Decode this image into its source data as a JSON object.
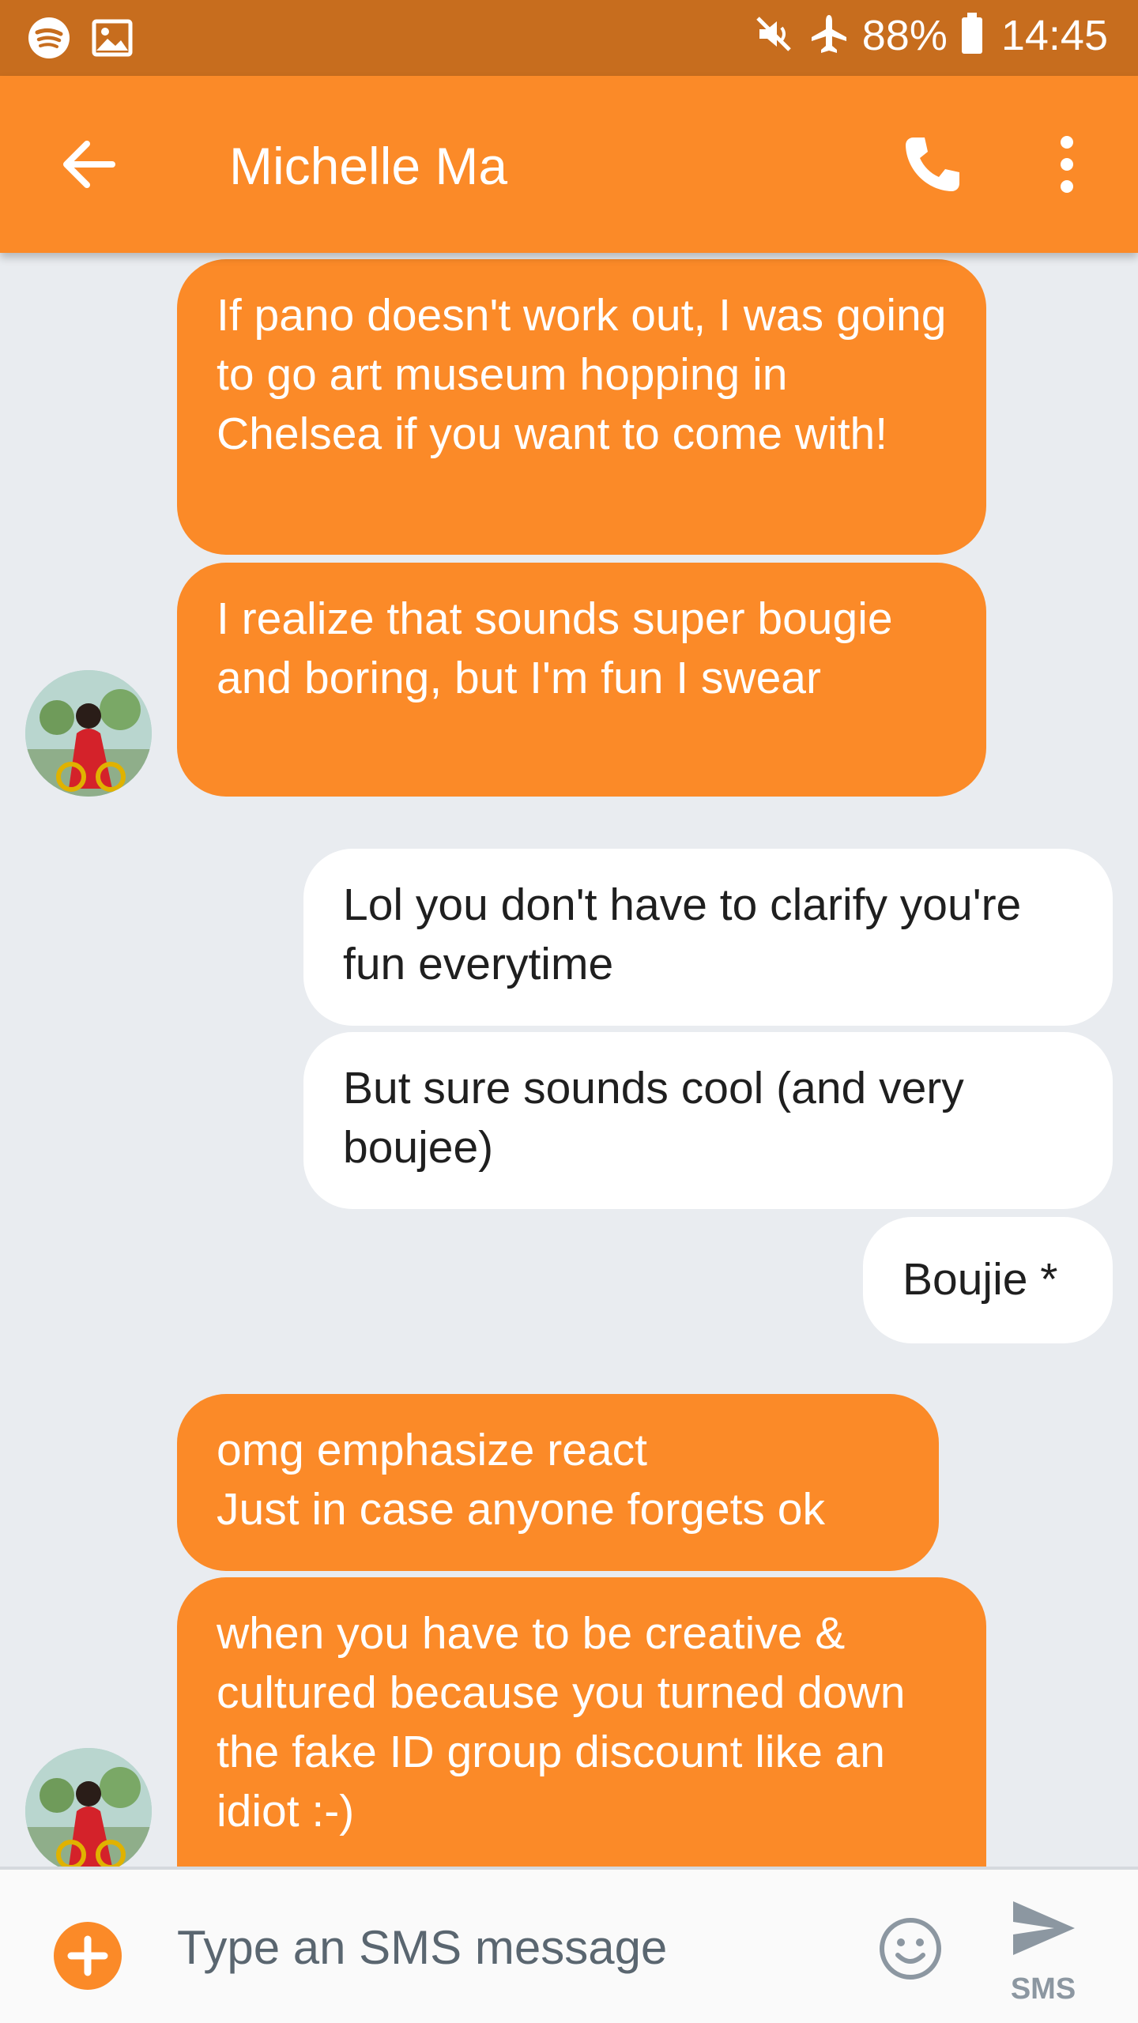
{
  "status_bar": {
    "left_icons": [
      "spotify-icon",
      "image-icon"
    ],
    "right_icons": [
      "mute-icon",
      "airplane-icon",
      "battery-icon"
    ],
    "battery": "88%",
    "time": "14:45"
  },
  "app_bar": {
    "title": "Michelle Ma",
    "back_icon": "arrow-back-icon",
    "call_icon": "phone-icon",
    "menu_icon": "more-vert-icon",
    "color": "#fb8a28"
  },
  "messages": [
    {
      "direction": "incoming",
      "text": "If pano doesn't work out, I was going to go art museum hopping in Chelsea if you want to come with!"
    },
    {
      "direction": "incoming",
      "text": "I realize that sounds super bougie and boring, but I'm fun I swear"
    },
    {
      "direction": "outgoing",
      "text": "Lol you don't have to clarify you're fun everytime"
    },
    {
      "direction": "outgoing",
      "text": "But sure sounds cool (and very boujee)"
    },
    {
      "direction": "outgoing",
      "text": "Boujie *"
    },
    {
      "direction": "incoming",
      "text": "omg emphasize react\nJust in case anyone forgets ok"
    },
    {
      "direction": "incoming",
      "text": "when you have to be creative & cultured because you turned down the fake ID group discount like an idiot :-)"
    }
  ],
  "compose": {
    "placeholder": "Type an SMS message",
    "send_label": "SMS",
    "add_icon": "add-circle-icon",
    "emoji_icon": "emoji-icon",
    "send_icon": "send-icon"
  },
  "colors": {
    "status_bar": "#c76d1e",
    "incoming_bubble": "#fb8a28",
    "outgoing_bubble": "#ffffff",
    "background": "#e9ecf0"
  }
}
